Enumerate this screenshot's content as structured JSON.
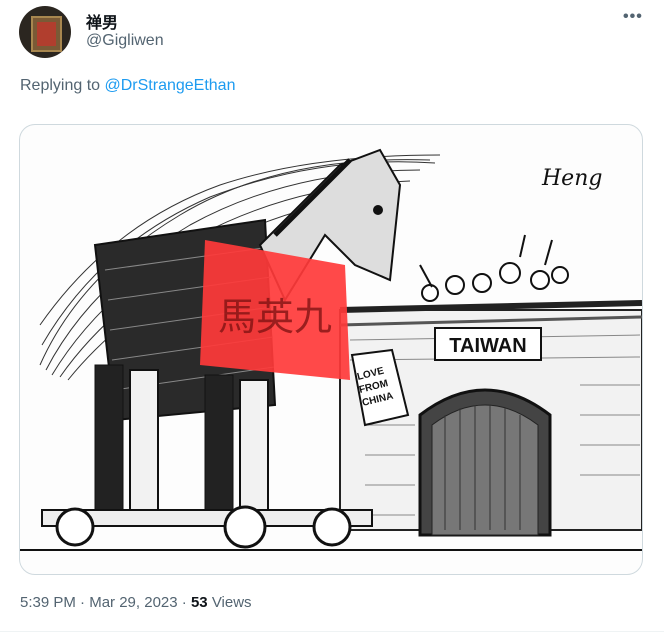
{
  "tweet": {
    "display_name": "禅男",
    "handle": "@Gigliwen",
    "more_label": "•••",
    "replying_prefix": "Replying to",
    "replying_to": "@DrStrangeEthan",
    "time": "5:39 PM",
    "sep1": " · ",
    "date": "Mar 29, 2023",
    "sep2": " · ",
    "views_count": "53",
    "views_label": "Views"
  },
  "cartoon": {
    "signature": "Heng",
    "wall_sign": "TAIWAN",
    "tag_text": [
      "LOVE",
      "FROM",
      "CHINA"
    ],
    "handwritten_overlay": "馬英九",
    "overlay_color": "#ff3a3a"
  }
}
